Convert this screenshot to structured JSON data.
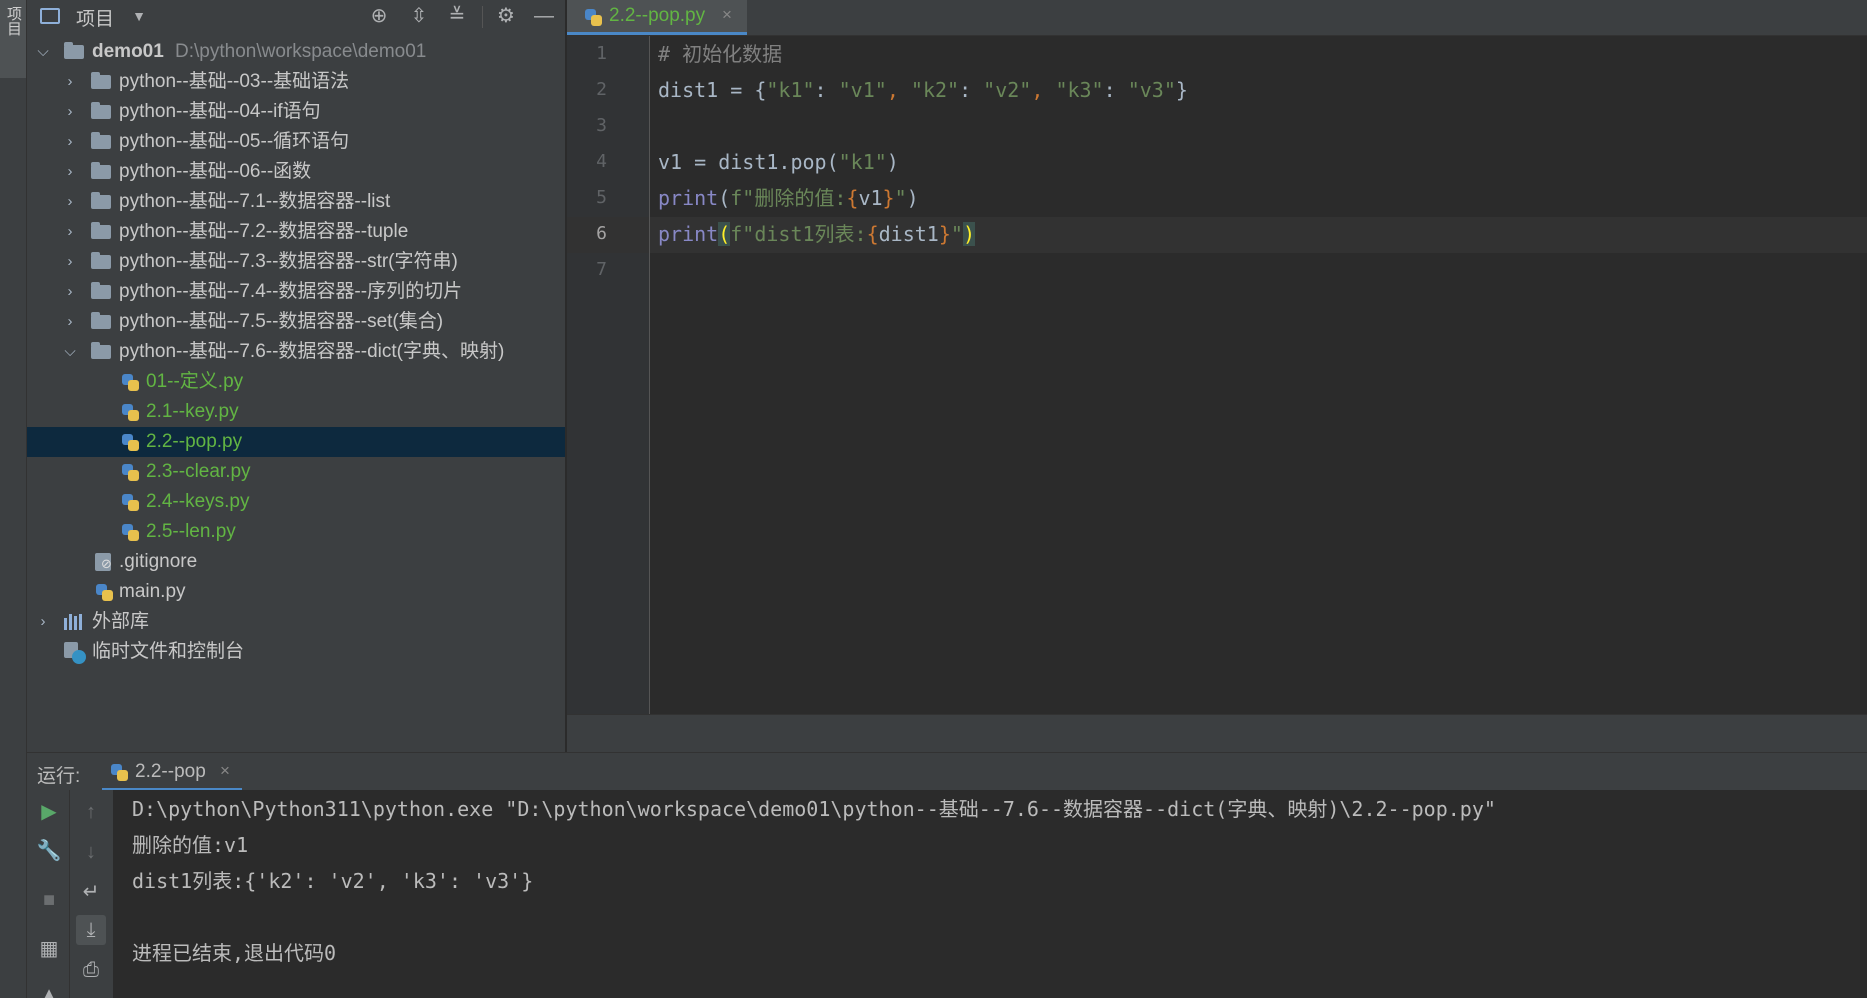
{
  "sidebar_strip": {
    "label": "项目"
  },
  "project": {
    "title": "项目",
    "root": {
      "name": "demo01",
      "path": "D:\\python\\workspace\\demo01"
    },
    "folders": [
      "python--基础--03--基础语法",
      "python--基础--04--if语句",
      "python--基础--05--循环语句",
      "python--基础--06--函数",
      "python--基础--7.1--数据容器--list",
      "python--基础--7.2--数据容器--tuple",
      "python--基础--7.3--数据容器--str(字符串)",
      "python--基础--7.4--数据容器--序列的切片",
      "python--基础--7.5--数据容器--set(集合)",
      "python--基础--7.6--数据容器--dict(字典、映射)"
    ],
    "files": [
      "01--定义.py",
      "2.1--key.py",
      "2.2--pop.py",
      "2.3--clear.py",
      "2.4--keys.py",
      "2.5--len.py"
    ],
    "root_files": [
      ".gitignore",
      "main.py"
    ],
    "external_libs": "外部库",
    "scratches": "临时文件和控制台"
  },
  "editor": {
    "tab_label": "2.2--pop.py",
    "tab_close": "×",
    "line_numbers": [
      "1",
      "2",
      "3",
      "4",
      "5",
      "6",
      "7"
    ],
    "code": {
      "l1": "# 初始化数据",
      "l2_a": "dist1 = {",
      "l2_k1": "\"k1\"",
      "l2_c1": ": ",
      "l2_v1": "\"v1\"",
      "l2_s1": ", ",
      "l2_k2": "\"k2\"",
      "l2_c2": ": ",
      "l2_v2": "\"v2\"",
      "l2_s2": ", ",
      "l2_k3": "\"k3\"",
      "l2_c3": ": ",
      "l2_v3": "\"v3\"",
      "l2_end": "}",
      "l4_a": "v1 = dist1.pop(",
      "l4_s": "\"k1\"",
      "l4_b": ")",
      "l5_fn": "print",
      "l5_p": "(",
      "l5_s1": "f\"删除的值:",
      "l5_b1": "{",
      "l5_var": "v1",
      "l5_b2": "}",
      "l5_s2": "\"",
      "l5_e": ")",
      "l6_fn": "print",
      "l6_p": "(",
      "l6_s1": "f\"dist1列表:",
      "l6_b1": "{",
      "l6_var": "dist1",
      "l6_b2": "}",
      "l6_s2": "\"",
      "l6_e": ")"
    }
  },
  "run": {
    "label": "运行:",
    "tab_label": "2.2--pop",
    "tab_close": "×",
    "console": [
      "D:\\python\\Python311\\python.exe \"D:\\python\\workspace\\demo01\\python--基础--7.6--数据容器--dict(字典、映射)\\2.2--pop.py\"",
      "删除的值:v1",
      "dist1列表:{'k2': 'v2', 'k3': 'v3'}",
      "",
      "进程已结束,退出代码0"
    ]
  },
  "colors": {
    "accent": "#4a88c7",
    "file_green": "#62b543",
    "selection": "#0d293e"
  }
}
